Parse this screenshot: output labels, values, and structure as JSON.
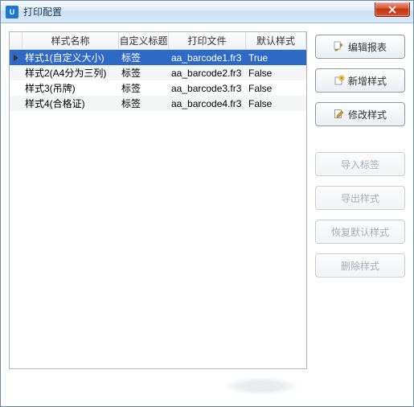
{
  "window": {
    "title": "打印配置"
  },
  "table": {
    "headers": {
      "name": "样式名称",
      "custom_title": "自定义标题",
      "print_file": "打印文件",
      "default_style": "默认样式"
    },
    "rows": [
      {
        "name": "样式1(自定义大小)",
        "custom_title": "标签",
        "print_file": "aa_barcode1.fr3",
        "default_style": "True",
        "selected": true
      },
      {
        "name": "样式2(A4分为三列)",
        "custom_title": "标签",
        "print_file": "aa_barcode2.fr3",
        "default_style": "False",
        "selected": false
      },
      {
        "name": "样式3(吊牌)",
        "custom_title": "标签",
        "print_file": "aa_barcode3.fr3",
        "default_style": "False",
        "selected": false
      },
      {
        "name": "样式4(合格证)",
        "custom_title": "标签",
        "print_file": "aa_barcode4.fr3",
        "default_style": "False",
        "selected": false
      }
    ]
  },
  "buttons": {
    "edit_report": "编辑报表",
    "new_style": "新增样式",
    "modify_style": "修改样式",
    "import_label": "导入标签",
    "export_style": "导出样式",
    "restore_default": "恢复默认样式",
    "delete_style": "删除样式"
  }
}
